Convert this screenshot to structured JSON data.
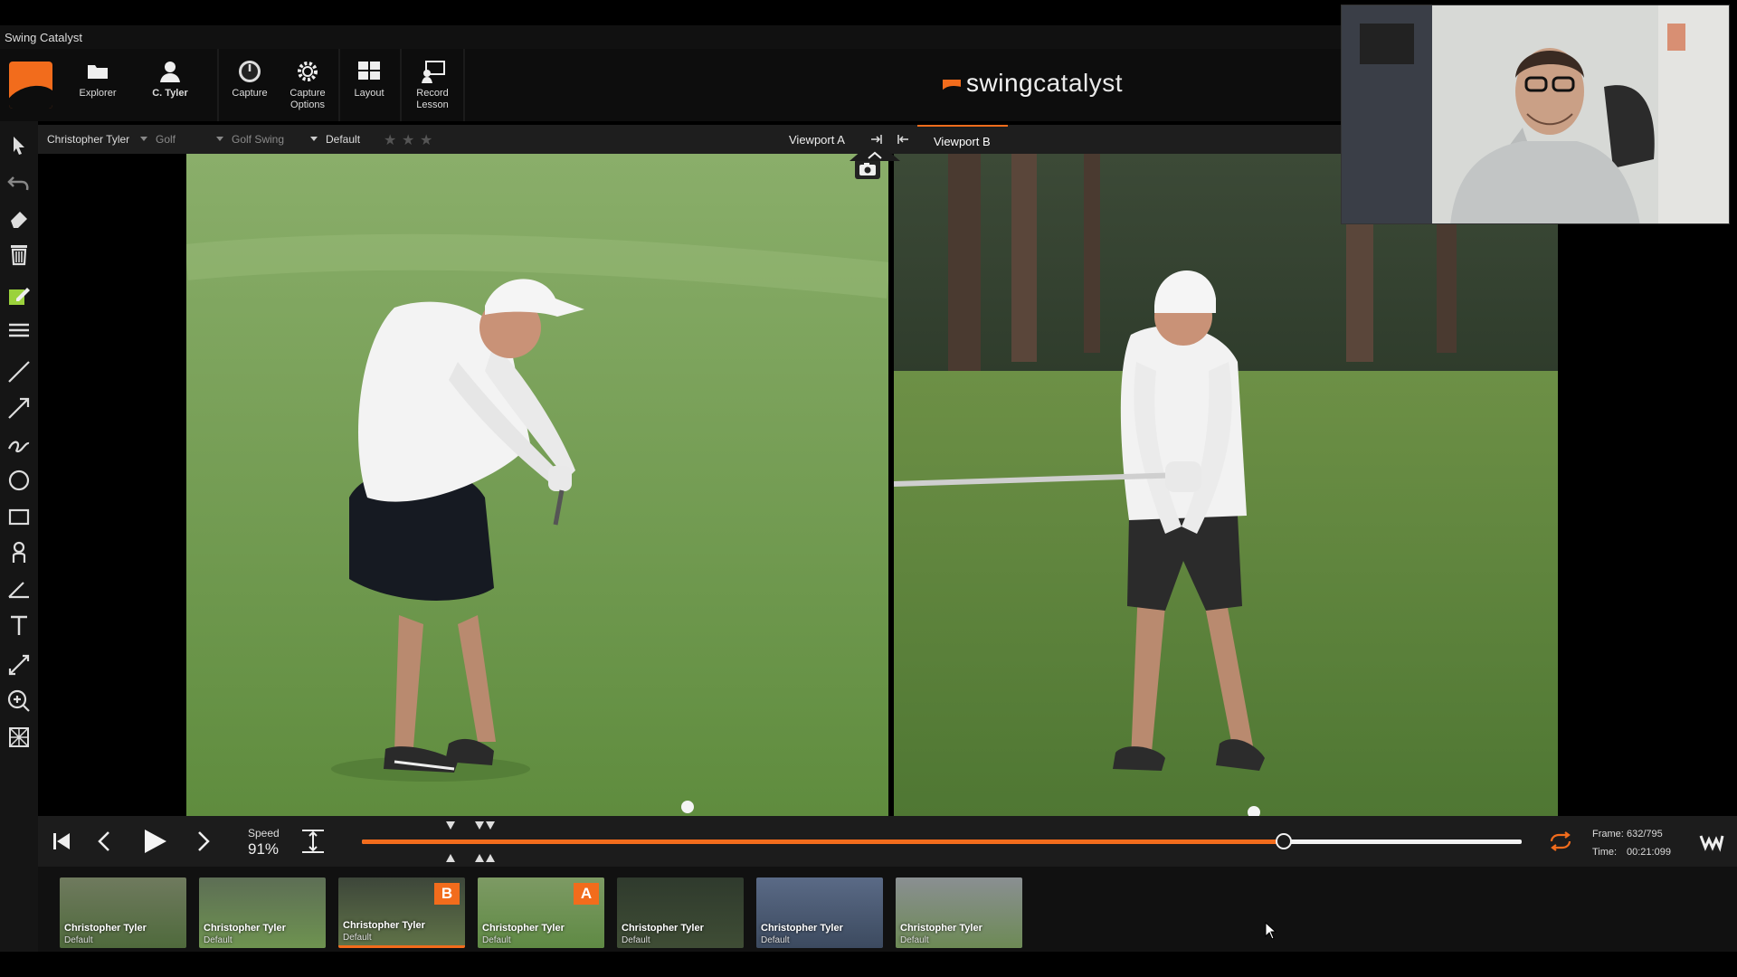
{
  "app": {
    "title": "Swing Catalyst",
    "brand_part1": "swing",
    "brand_part2": "catalyst"
  },
  "ribbon": {
    "explorer": "Explorer",
    "user": "C. Tyler",
    "capture": "Capture",
    "capture_options_1": "Capture",
    "capture_options_2": "Options",
    "layout": "Layout",
    "record_1": "Record",
    "record_2": "Lesson"
  },
  "viewportA": {
    "athlete": "Christopher Tyler",
    "sport": "Golf",
    "category": "Golf Swing",
    "preset": "Default",
    "label": "Viewport A",
    "rating_stars": 3
  },
  "viewportB": {
    "label": "Viewport B"
  },
  "transport": {
    "speed_label": "Speed",
    "speed_value": "91%",
    "frame_label": "Frame:",
    "frame_value": "632/795",
    "time_label": "Time:",
    "time_value": "00:21:099",
    "progress": 0.795
  },
  "clips": [
    {
      "name": "Christopher Tyler",
      "sub": "Default",
      "badge": ""
    },
    {
      "name": "Christopher Tyler",
      "sub": "Default",
      "badge": ""
    },
    {
      "name": "Christopher Tyler",
      "sub": "Default",
      "badge": "B"
    },
    {
      "name": "Christopher Tyler",
      "sub": "Default",
      "badge": "A"
    },
    {
      "name": "Christopher Tyler",
      "sub": "Default",
      "badge": ""
    },
    {
      "name": "Christopher Tyler",
      "sub": "Default",
      "badge": ""
    },
    {
      "name": "Christopher Tyler",
      "sub": "Default",
      "badge": ""
    }
  ],
  "colors": {
    "accent": "#f26c1c",
    "panel": "#1c1c1c",
    "toolbar": "#151515"
  },
  "icons": [
    "select-arrow-icon",
    "undo-icon",
    "eraser-icon",
    "trash-icon",
    "note-icon",
    "list-icon",
    "line-icon",
    "arrow-icon",
    "freehand-icon",
    "circle-icon",
    "rectangle-icon",
    "body-icon",
    "angle-icon",
    "text-icon",
    "measure-icon",
    "zoom-icon",
    "grid-icon"
  ]
}
